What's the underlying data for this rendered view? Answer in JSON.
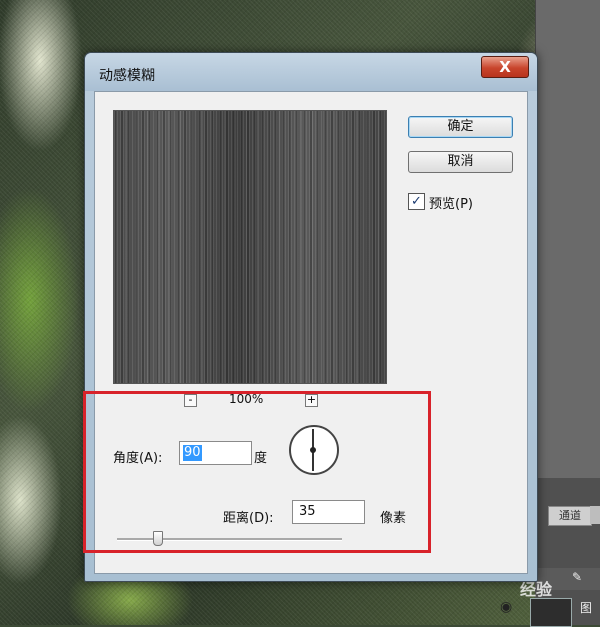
{
  "dialog": {
    "title": "动感模糊",
    "close_label": "X",
    "zoom": {
      "out_label": "-",
      "in_label": "+",
      "level": "100%"
    },
    "buttons": {
      "ok": "确定",
      "cancel": "取消"
    },
    "preview_checkbox": {
      "label": "预览(P)",
      "checked": true,
      "check_glyph": "✓"
    },
    "angle": {
      "label": "角度(A):",
      "value": "90",
      "unit": "度"
    },
    "distance": {
      "label": "距离(D):",
      "value": "35",
      "unit": "像素"
    },
    "slider": {
      "value_fraction": 0.18
    }
  },
  "photoshop": {
    "panel_tab": "通道",
    "layer_label": "图",
    "brush_icon": "✎",
    "eye_icon": "◉"
  },
  "watermark": "经验",
  "colors": {
    "highlight": "#d8222a",
    "selection": "#3399ff",
    "close": "#c8452d"
  }
}
